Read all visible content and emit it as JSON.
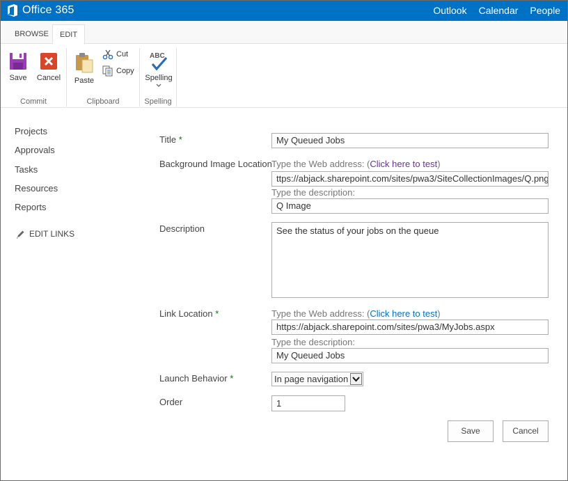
{
  "suite": {
    "brand": "Office 365",
    "links": [
      "Outlook",
      "Calendar",
      "People"
    ]
  },
  "ribbon": {
    "tabs": [
      "BROWSE",
      "EDIT"
    ],
    "active_tab": "EDIT",
    "commit": {
      "label": "Commit",
      "save": "Save",
      "cancel": "Cancel"
    },
    "clipboard": {
      "label": "Clipboard",
      "paste": "Paste",
      "cut": "Cut",
      "copy": "Copy"
    },
    "spelling": {
      "label": "Spelling",
      "button": "Spelling",
      "abc": "ABC"
    }
  },
  "nav": {
    "items": [
      "Projects",
      "Approvals",
      "Tasks",
      "Resources",
      "Reports"
    ],
    "edit_links": "EDIT LINKS"
  },
  "form": {
    "title": {
      "label": "Title",
      "required": "*",
      "value": "My Queued Jobs"
    },
    "background": {
      "label": "Background Image Location",
      "hint_prefix": "Type the Web address: (",
      "hint_link": "Click here to test",
      "hint_suffix": ")",
      "url_value": "ttps://abjack.sharepoint.com/sites/pwa3/SiteCollectionImages/Q.png",
      "desc_hint": "Type the description:",
      "desc_value": "Q Image"
    },
    "description": {
      "label": "Description",
      "value": "See the status of your jobs on the queue"
    },
    "link": {
      "label": "Link Location",
      "required": "*",
      "hint_prefix": "Type the Web address: (",
      "hint_link": "Click here to test",
      "hint_suffix": ")",
      "url_value": "https://abjack.sharepoint.com/sites/pwa3/MyJobs.aspx",
      "desc_hint": "Type the description:",
      "desc_value": "My Queued Jobs"
    },
    "launch": {
      "label": "Launch Behavior",
      "required": "*",
      "value": "In page navigation"
    },
    "order": {
      "label": "Order",
      "value": "1"
    },
    "buttons": {
      "save": "Save",
      "cancel": "Cancel"
    }
  },
  "colors": {
    "suitebar": "#0072c6",
    "link": "#0072c6",
    "visited_link": "#663399",
    "required": "#007f00"
  }
}
